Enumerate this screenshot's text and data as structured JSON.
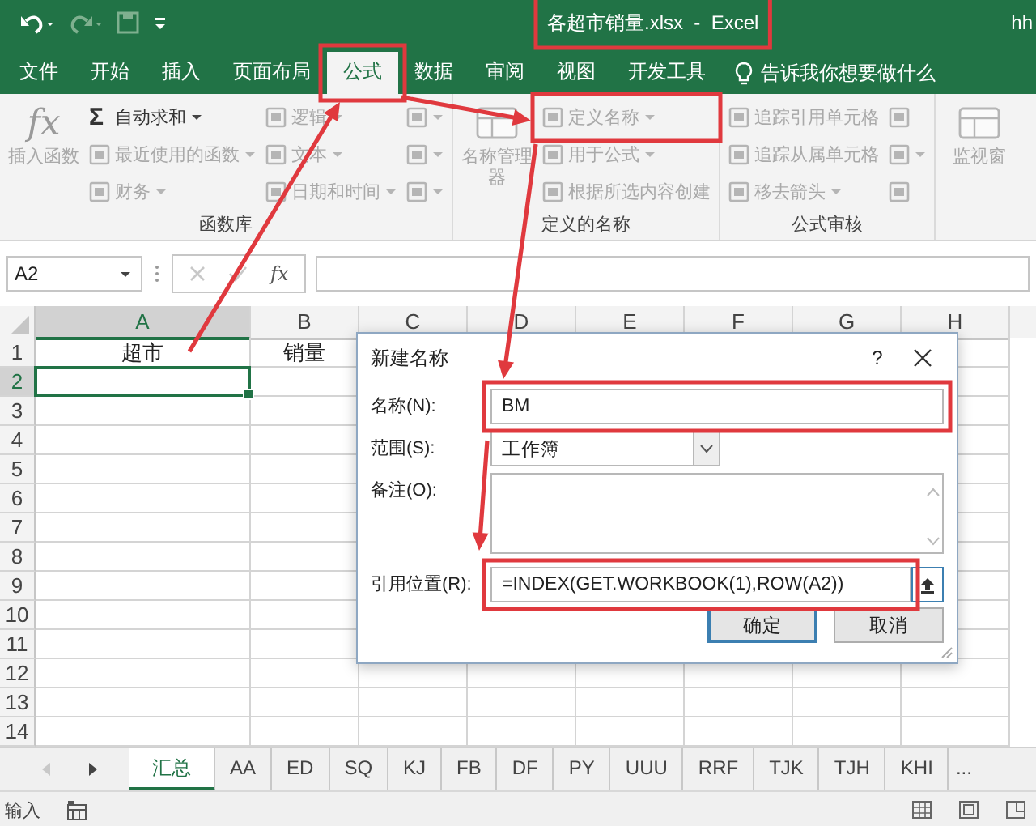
{
  "window": {
    "title": "各超市销量.xlsx  -  Excel",
    "user": "hh",
    "annotated": true
  },
  "tabs": [
    {
      "label": "文件",
      "selected": false
    },
    {
      "label": "开始",
      "selected": false
    },
    {
      "label": "插入",
      "selected": false
    },
    {
      "label": "页面布局",
      "selected": false
    },
    {
      "label": "公式",
      "selected": true,
      "annotated": true
    },
    {
      "label": "数据",
      "selected": false
    },
    {
      "label": "审阅",
      "selected": false
    },
    {
      "label": "视图",
      "selected": false
    },
    {
      "label": "开发工具",
      "selected": false
    }
  ],
  "tell_me": "告诉我你想要做什么",
  "ribbon_groups": [
    {
      "label": "函数库",
      "columns": [
        [
          {
            "kind": "large",
            "icon_text": "fx",
            "label": "插入函数",
            "disabled": true
          }
        ],
        [
          {
            "kind": "small",
            "icon_text": "Σ",
            "label": "自动求和",
            "dropdown": true,
            "disabled": false
          },
          {
            "kind": "small",
            "label": "最近使用的函数",
            "dropdown": true,
            "disabled": true
          },
          {
            "kind": "small",
            "label": "财务",
            "dropdown": true,
            "disabled": true
          }
        ],
        [
          {
            "kind": "small",
            "label": "逻辑",
            "dropdown": true,
            "disabled": true
          },
          {
            "kind": "small",
            "label": "文本",
            "dropdown": true,
            "disabled": true
          },
          {
            "kind": "small",
            "label": "日期和时间",
            "dropdown": true,
            "disabled": true
          }
        ],
        [
          {
            "kind": "icon",
            "dropdown": true,
            "disabled": true
          },
          {
            "kind": "icon",
            "dropdown": true,
            "disabled": true
          },
          {
            "kind": "icon",
            "dropdown": true,
            "disabled": true
          }
        ]
      ]
    },
    {
      "label": "定义的名称",
      "columns": [
        [
          {
            "kind": "large",
            "label": "名称管理器",
            "disabled": true
          }
        ],
        [
          {
            "kind": "small",
            "label": "定义名称",
            "dropdown": true,
            "disabled": true,
            "annotated": true
          },
          {
            "kind": "small",
            "label": "用于公式",
            "dropdown": true,
            "disabled": true
          },
          {
            "kind": "small",
            "label": "根据所选内容创建",
            "dropdown": false,
            "disabled": true
          }
        ]
      ]
    },
    {
      "label": "公式审核",
      "columns": [
        [
          {
            "kind": "small",
            "label": "追踪引用单元格",
            "dropdown": false,
            "disabled": true
          },
          {
            "kind": "small",
            "label": "追踪从属单元格",
            "dropdown": false,
            "disabled": true
          },
          {
            "kind": "small",
            "label": "移去箭头",
            "dropdown": true,
            "disabled": true
          }
        ],
        [
          {
            "kind": "icon",
            "dropdown": false,
            "disabled": true
          },
          {
            "kind": "icon",
            "dropdown": true,
            "disabled": true
          },
          {
            "kind": "icon",
            "dropdown": false,
            "disabled": true
          }
        ]
      ]
    },
    {
      "columns": [
        [
          {
            "kind": "large",
            "label": "监视窗",
            "disabled": true
          }
        ]
      ]
    }
  ],
  "formula_bar": {
    "name_box": "A2",
    "fx": "fx"
  },
  "sheet": {
    "columns": [
      "A",
      "B",
      "C",
      "D",
      "E",
      "F",
      "G",
      "H"
    ],
    "rows": [
      {
        "header": "1",
        "cells": [
          {
            "text": "超市",
            "selected": false
          },
          {
            "text": "销量",
            "selected": false
          }
        ]
      },
      {
        "header": "2",
        "cells": [
          {
            "selected": true
          }
        ]
      },
      {
        "header": "3"
      },
      {
        "header": "4"
      },
      {
        "header": "5"
      },
      {
        "header": "6"
      },
      {
        "header": "7"
      },
      {
        "header": "8"
      },
      {
        "header": "9"
      },
      {
        "header": "10"
      },
      {
        "header": "11"
      },
      {
        "header": "12"
      },
      {
        "header": "13"
      },
      {
        "header": "14"
      }
    ]
  },
  "sheet_tabs": {
    "items": [
      {
        "label": "汇总",
        "selected": true
      },
      {
        "label": "AA",
        "selected": false
      },
      {
        "label": "ED",
        "selected": false
      },
      {
        "label": "SQ",
        "selected": false
      },
      {
        "label": "KJ",
        "selected": false
      },
      {
        "label": "FB",
        "selected": false
      },
      {
        "label": "DF",
        "selected": false
      },
      {
        "label": "PY",
        "selected": false
      },
      {
        "label": "UUU",
        "selected": false
      },
      {
        "label": "RRF",
        "selected": false
      },
      {
        "label": "TJK",
        "selected": false
      },
      {
        "label": "TJH",
        "selected": false
      },
      {
        "label": "KHI",
        "selected": false
      }
    ],
    "more": "..."
  },
  "status_bar": {
    "mode": "输入"
  },
  "dialog": {
    "title": "新建名称",
    "help": "?",
    "fields": [
      {
        "kind": "text",
        "label": "名称(N):",
        "value": "BM",
        "annotated": true
      },
      {
        "kind": "dropdown",
        "label": "范围(S):",
        "value": "工作簿"
      },
      {
        "kind": "textarea",
        "label": "备注(O):"
      },
      {
        "kind": "reference",
        "label": "引用位置(R):",
        "value": "=INDEX(GET.WORKBOOK(1),ROW(A2))",
        "annotated": true
      }
    ],
    "buttons": [
      {
        "label": "确定",
        "default": true
      },
      {
        "label": "取消",
        "default": false
      }
    ]
  }
}
